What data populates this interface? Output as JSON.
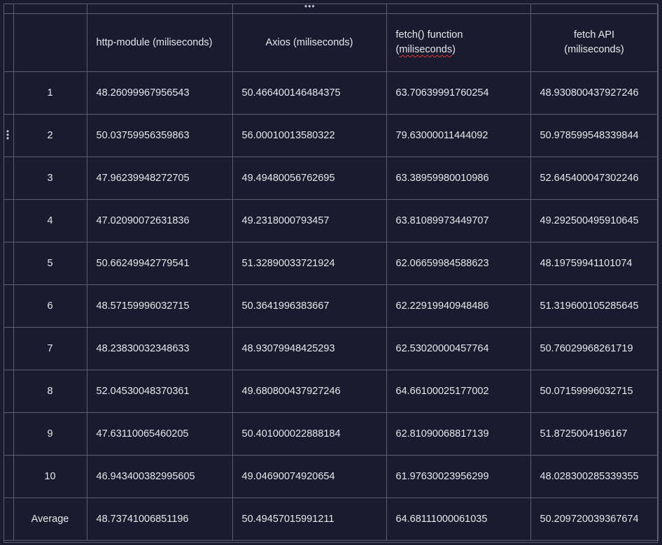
{
  "table": {
    "headers": {
      "col1": "http-module (miliseconds)",
      "col2": "Axios (miliseconds)",
      "col3_line1": "fetch() function",
      "col3_line2": "miliseconds",
      "col4_line1": "fetch API",
      "col4_line2": "(miliseconds)"
    },
    "rows": [
      {
        "label": "1",
        "http": "48.26099967956543",
        "axios": "50.466400146484375",
        "fetch_fn": "63.70639991760254",
        "fetch_api": "48.930800437927246"
      },
      {
        "label": "2",
        "http": "50.03759956359863",
        "axios": "56.00010013580322",
        "fetch_fn": "79.63000011444092",
        "fetch_api": "50.978599548339844"
      },
      {
        "label": "3",
        "http": "47.96239948272705",
        "axios": "49.49480056762695",
        "fetch_fn": "63.38959980010986",
        "fetch_api": "52.645400047302246"
      },
      {
        "label": "4",
        "http": "47.02090072631836",
        "axios": "49.2318000793457",
        "fetch_fn": "63.81089973449707",
        "fetch_api": "49.292500495910645"
      },
      {
        "label": "5",
        "http": "50.66249942779541",
        "axios": "51.32890033721924",
        "fetch_fn": "62.06659984588623",
        "fetch_api": "48.19759941101074"
      },
      {
        "label": "6",
        "http": "48.57159996032715",
        "axios": "50.3641996383667",
        "fetch_fn": "62.22919940948486",
        "fetch_api": "51.319600105285645"
      },
      {
        "label": "7",
        "http": "48.23830032348633",
        "axios": "48.93079948425293",
        "fetch_fn": "62.53020000457764",
        "fetch_api": "50.76029968261719"
      },
      {
        "label": "8",
        "http": "52.04530048370361",
        "axios": "49.680800437927246",
        "fetch_fn": "64.66100025177002",
        "fetch_api": "50.07159996032715"
      },
      {
        "label": "9",
        "http": "47.63110065460205",
        "axios": "50.401000022888184",
        "fetch_fn": "62.81090068817139",
        "fetch_api": "51.8725004196167"
      },
      {
        "label": "10",
        "http": "46.943400382995605",
        "axios": "49.04690074920654",
        "fetch_fn": "61.97630023956299",
        "fetch_api": "48.028300285339355"
      },
      {
        "label": "Average",
        "http": "48.73741006851196",
        "axios": "50.49457015991211",
        "fetch_fn": "64.68111000061035",
        "fetch_api": "50.209720039367674"
      }
    ]
  },
  "icons": {
    "column_menu": "horizontal-ellipsis-icon",
    "row_menu": "vertical-ellipsis-icon"
  },
  "colors": {
    "background": "#1a1b2e",
    "grid": "#5a5e72",
    "text": "#e6e7ec",
    "spellcheck": "#e03a3a"
  }
}
